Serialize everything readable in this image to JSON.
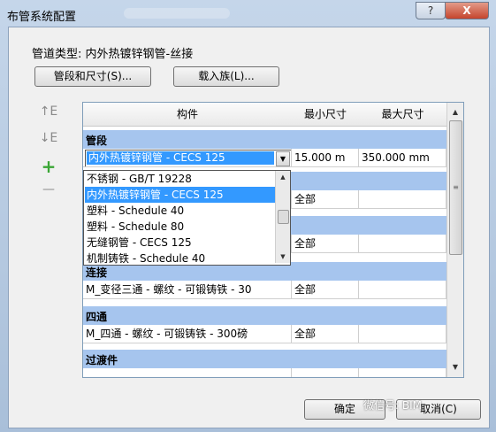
{
  "window": {
    "title": "布管系统配置",
    "help_label": "?",
    "close_label": "X"
  },
  "pipe_type": "管道类型:  内外热镀锌钢管-丝接",
  "toolbar": {
    "segments_label": "管段和尺寸(S)...",
    "load_family_label": "载入族(L)..."
  },
  "side_icons": [
    "move-up-icon",
    "move-down-icon",
    "add-icon",
    "remove-icon"
  ],
  "grid": {
    "headers": [
      "构件",
      "最小尺寸",
      "最大尺寸"
    ],
    "sections": {
      "segment": "管段",
      "connection": "连接",
      "cross": "四通",
      "transition": "过渡件"
    },
    "segment_row": {
      "value": "内外热镀锌钢管 - CECS 125",
      "min": "15.000 m",
      "max": "350.000 mm"
    },
    "hidden_rows": [
      {
        "min": "全部",
        "max": ""
      },
      {
        "min": "全部",
        "max": ""
      }
    ],
    "connection_row": {
      "name": "M_变径三通 - 螺纹 - 可锻铸铁 - 30",
      "min": "全部",
      "max": ""
    },
    "cross_row": {
      "name": "M_四通 - 螺纹 - 可锻铸铁 - 300磅",
      "min": "全部",
      "max": ""
    },
    "transition_row": {
      "name": "",
      "min": "",
      "max": ""
    }
  },
  "dropdown": {
    "items": [
      "不锈钢 - GB/T 19228",
      "内外热镀锌钢管 - CECS 125",
      "塑料 - Schedule 40",
      "塑料 - Schedule 80",
      "无缝钢管 - CECS 125",
      "机制铸铁 - Schedule 40"
    ],
    "selected_index": 1
  },
  "buttons": {
    "ok": "确定",
    "cancel": "取消(C)"
  },
  "watermark": "微信号: BIM"
}
